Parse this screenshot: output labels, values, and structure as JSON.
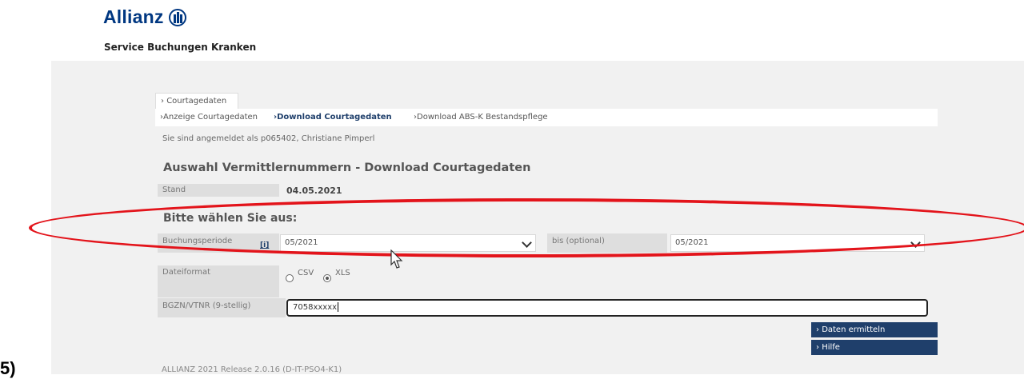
{
  "brand": {
    "name": "Allianz",
    "app_title": "Service Buchungen Kranken"
  },
  "tabs": {
    "main": "Courtagedaten"
  },
  "subnav": [
    {
      "label": "Anzeige Courtagedaten",
      "active": false
    },
    {
      "label": "Download Courtagedaten",
      "active": true
    },
    {
      "label": "Download ABS-K Bestandspflege",
      "active": false
    }
  ],
  "login_text": "Sie sind angemeldet als p065402, Christiane Pimperl",
  "page_title": "Auswahl Vermittlernummern - Download Courtagedaten",
  "stand": {
    "label": "Stand",
    "value": "04.05.2021"
  },
  "section_title": "Bitte wählen Sie aus:",
  "buchungsperiode": {
    "label": "Buchungsperiode",
    "info": "[i]",
    "value": "05/2021"
  },
  "bis": {
    "label": "bis (optional)",
    "value": "05/2021"
  },
  "dateiformat": {
    "label": "Dateiformat",
    "options": [
      "CSV",
      "XLS"
    ],
    "selected": "XLS"
  },
  "bgzn": {
    "label": "BGZN/VTNR (9-stellig)",
    "value": "7058xxxxx"
  },
  "buttons": {
    "daten": "Daten ermitteln",
    "hilfe": "Hilfe"
  },
  "footer": "ALLIANZ 2021 Release 2.0.16 (D-IT-PSO4-K1)",
  "annotation": {
    "number": "5)",
    "highlight_color": "#e3141b"
  }
}
